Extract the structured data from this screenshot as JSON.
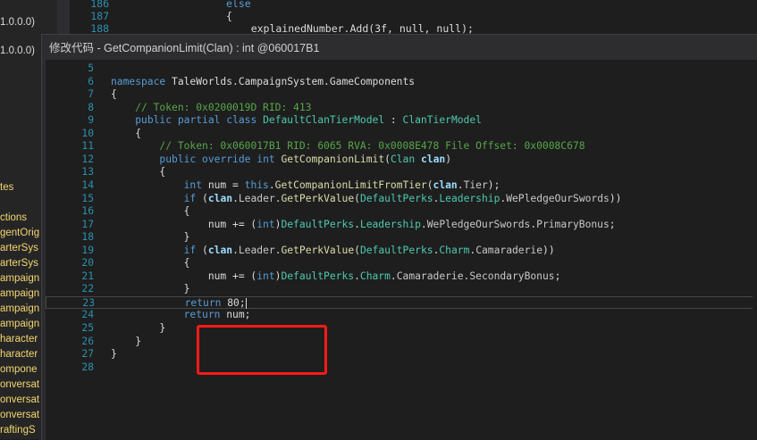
{
  "left_panel": {
    "items": [
      "1.0.0.0)",
      "1.0.0.0)",
      "tes",
      "ctions",
      "gentOrig",
      "arterSys",
      "arterSys",
      "ampaign",
      "ampaign",
      "ampaign",
      "ampaign",
      "haracter",
      "haracter",
      "ompone",
      "onversat",
      "onversat",
      "onversat",
      "raftingS"
    ]
  },
  "background_editor": {
    "lines": [
      {
        "num": "186",
        "text": "else"
      },
      {
        "num": "187",
        "text": "{"
      },
      {
        "num": "188",
        "text": "    explainedNumber.Add(3f, null, null);"
      }
    ]
  },
  "dialog": {
    "title": "修改代码 - GetCompanionLimit(Clan) : int @060017B1"
  },
  "code": {
    "lines": [
      {
        "num": "5",
        "html": ""
      },
      {
        "num": "6",
        "html": "<span class='kw'>namespace</span> TaleWorlds.CampaignSystem.GameComponents"
      },
      {
        "num": "7",
        "html": "{"
      },
      {
        "num": "8",
        "html": "    <span class='cm'>// Token: 0x0200019D RID: 413</span>"
      },
      {
        "num": "9",
        "html": "    <span class='kw'>public</span> <span class='kw'>partial</span> <span class='kw'>class</span> <span class='ty'>DefaultClanTierModel</span> : <span class='ty'>ClanTierModel</span>"
      },
      {
        "num": "10",
        "html": "    {"
      },
      {
        "num": "11",
        "html": "        <span class='cm'>// Token: 0x060017B1 RID: 6065 RVA: 0x0008E478 File Offset: 0x0008C678</span>"
      },
      {
        "num": "12",
        "html": "        <span class='kw'>public</span> <span class='kw'>override</span> <span class='kw'>int</span> <span class='mt'>GetCompanionLimit</span>(<span class='ty'>Clan</span> <span class='pm'>clan</span>)"
      },
      {
        "num": "13",
        "html": "        {"
      },
      {
        "num": "14",
        "html": "            <span class='kw'>int</span> num = <span class='kw'>this</span>.<span class='mt'>GetCompanionLimitFromTier</span>(<span class='pm'>clan</span>.<span class='pr'>Tier</span>);"
      },
      {
        "num": "15",
        "html": "            <span class='kw'>if</span> (<span class='pm'>clan</span>.<span class='pr'>Leader</span>.<span class='mt'>GetPerkValue</span>(<span class='ty'>DefaultPerks</span>.<span class='ty'>Leadership</span>.<span class='pr'>WePledgeOurSwords</span>))"
      },
      {
        "num": "16",
        "html": "            {"
      },
      {
        "num": "17",
        "html": "                num += (<span class='kw'>int</span>)<span class='ty'>DefaultPerks</span>.<span class='ty'>Leadership</span>.<span class='pr'>WePledgeOurSwords</span>.<span class='pr'>PrimaryBonus</span>;"
      },
      {
        "num": "18",
        "html": "            }"
      },
      {
        "num": "19",
        "html": "            <span class='kw'>if</span> (<span class='pm'>clan</span>.<span class='pr'>Leader</span>.<span class='mt'>GetPerkValue</span>(<span class='ty'>DefaultPerks</span>.<span class='ty'>Charm</span>.<span class='pr'>Camaraderie</span>))"
      },
      {
        "num": "20",
        "html": "            {"
      },
      {
        "num": "21",
        "html": "                num += (<span class='kw'>int</span>)<span class='ty'>DefaultPerks</span>.<span class='ty'>Charm</span>.<span class='pr'>Camaraderie</span>.<span class='pr'>SecondaryBonus</span>;"
      },
      {
        "num": "22",
        "html": "            }"
      },
      {
        "num": "23",
        "html": "            <span class='kw'>return</span> 80;<span class='caret'></span>",
        "current": true
      },
      {
        "num": "24",
        "html": "            <span class='kw'>return</span> num;"
      },
      {
        "num": "25",
        "html": "        }"
      },
      {
        "num": "26",
        "html": "    }"
      },
      {
        "num": "27",
        "html": "}"
      },
      {
        "num": "28",
        "html": ""
      }
    ]
  },
  "colors": {
    "highlight_box": "#ff1a1a",
    "keyword": "#569cd6",
    "comment": "#57a64a",
    "type": "#4ec9b0",
    "method": "#dcdcaa",
    "line_number": "#2b91af"
  }
}
